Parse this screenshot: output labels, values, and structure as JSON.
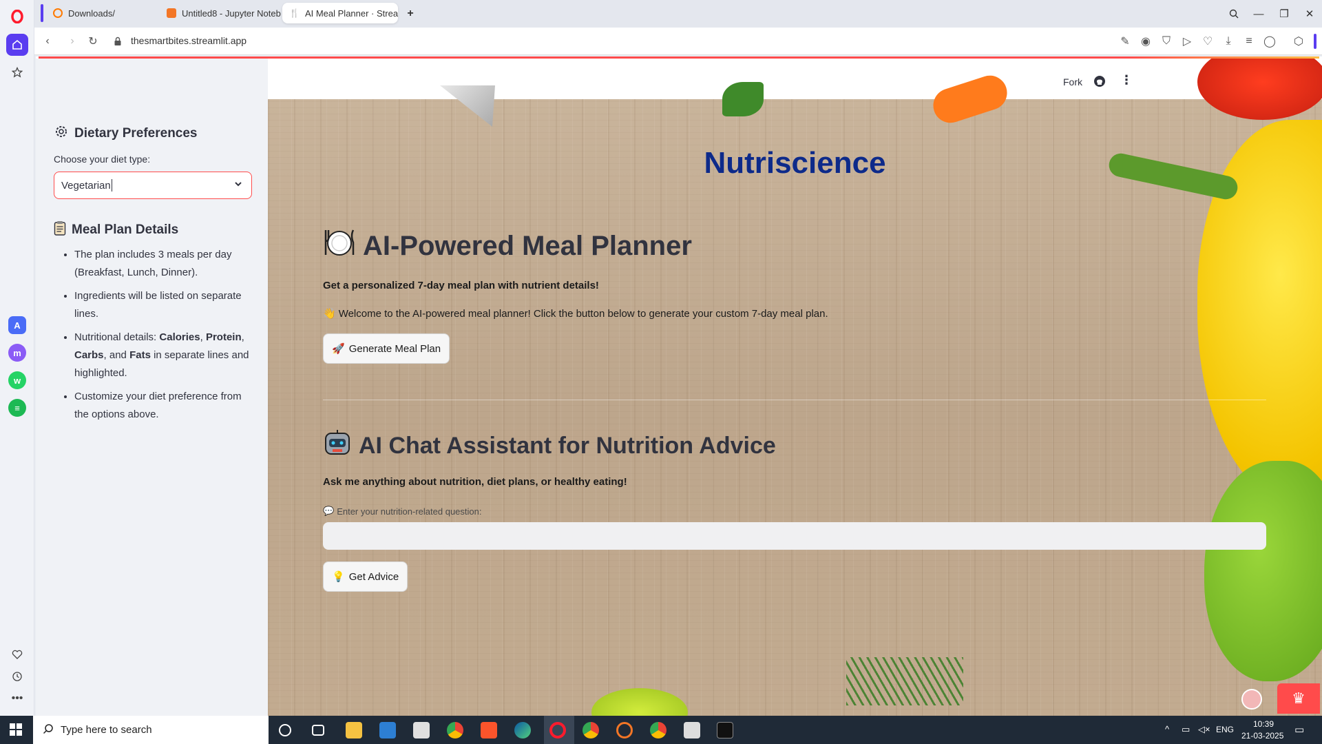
{
  "browser": {
    "tabs": [
      {
        "label": "Downloads/",
        "active": false
      },
      {
        "label": "Untitled8 - Jupyter Noteb",
        "active": false
      },
      {
        "label": "AI Meal Planner · Streamlit",
        "active": true
      }
    ],
    "url": "thesmartbites.streamlit.app"
  },
  "header": {
    "fork_label": "Fork"
  },
  "sidebar": {
    "dietary_title": "Dietary Preferences",
    "diet_label": "Choose your diet type:",
    "diet_value": "Vegetarian",
    "details_title": "Meal Plan Details",
    "details": [
      {
        "pre": "The plan includes 3 meals per day (Breakfast, Lunch, Dinner).",
        "b1": "",
        "m1": "",
        "b2": "",
        "m2": "",
        "b3": "",
        "m3": "",
        "b4": "",
        "post": ""
      },
      {
        "pre": "Ingredients will be listed on separate lines.",
        "b1": "",
        "m1": "",
        "b2": "",
        "m2": "",
        "b3": "",
        "m3": "",
        "b4": "",
        "post": ""
      },
      {
        "pre": "Nutritional details: ",
        "b1": "Calories",
        "m1": ", ",
        "b2": "Protein",
        "m2": ", ",
        "b3": "Carbs",
        "m3": ", and ",
        "b4": "Fats",
        "post": " in separate lines and highlighted."
      },
      {
        "pre": "Customize your diet preference from the options above.",
        "b1": "",
        "m1": "",
        "b2": "",
        "m2": "",
        "b3": "",
        "m3": "",
        "b4": "",
        "post": ""
      }
    ]
  },
  "main": {
    "app_title": "Nutriscience",
    "planner_title": "AI-Powered Meal Planner",
    "planner_subtitle": "Get a personalized 7-day meal plan with nutrient details!",
    "welcome": "Welcome to the AI-powered meal planner! Click the button below to generate your custom 7-day meal plan.",
    "generate_button": "Generate Meal Plan",
    "chat_title": "AI Chat Assistant for Nutrition Advice",
    "chat_subtitle": "Ask me anything about nutrition, diet plans, or healthy eating!",
    "question_label": "Enter your nutrition-related question:",
    "question_value": "",
    "advice_button": "Get Advice"
  },
  "taskbar": {
    "search_placeholder": "Type here to search",
    "language": "ENG",
    "time": "10:39",
    "date": "21-03-2025"
  },
  "colors": {
    "streamlit_red": "#ff4b4b",
    "title_blue": "#0d2a8a",
    "opera_red": "#ff1b2d"
  }
}
